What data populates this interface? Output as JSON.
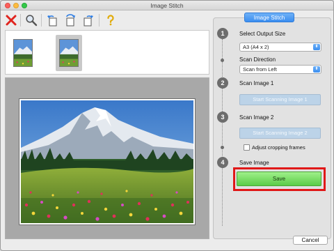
{
  "window": {
    "title": "Image Stitch"
  },
  "toolbar": {
    "buttons": [
      {
        "icon": "close-icon",
        "color": "#e0241e"
      },
      {
        "icon": "zoom-icon"
      },
      {
        "icon": "rotate-left-icon"
      },
      {
        "icon": "rotate-180-icon"
      },
      {
        "icon": "rotate-right-icon"
      },
      {
        "icon": "help-icon",
        "color": "#f2c31d"
      }
    ]
  },
  "thumbnails": {
    "count": 2,
    "selected_index": 1
  },
  "panel": {
    "title": "Image Stitch",
    "steps": [
      {
        "number": "1",
        "label": "Select Output Size"
      },
      {
        "number": "2",
        "label": "Scan Image 1"
      },
      {
        "number": "3",
        "label": "Scan Image 2"
      },
      {
        "number": "4",
        "label": "Save Image"
      }
    ],
    "output_size": {
      "value": "A3 (A4 x 2)"
    },
    "scan_direction": {
      "label": "Scan Direction",
      "value": "Scan from Left"
    },
    "scan_image_1_button": "Start Scanning Image 1",
    "scan_image_2_button": "Start Scanning Image 2",
    "adjust_cropping": {
      "label": "Adjust cropping frames",
      "checked": false
    },
    "save_button": "Save"
  },
  "footer": {
    "cancel_button": "Cancel"
  },
  "colors": {
    "accent_blue": "#3b8ef0",
    "save_green": "#5bcc48",
    "highlight_red": "#e01818",
    "step_circle": "#6d6d6d"
  }
}
